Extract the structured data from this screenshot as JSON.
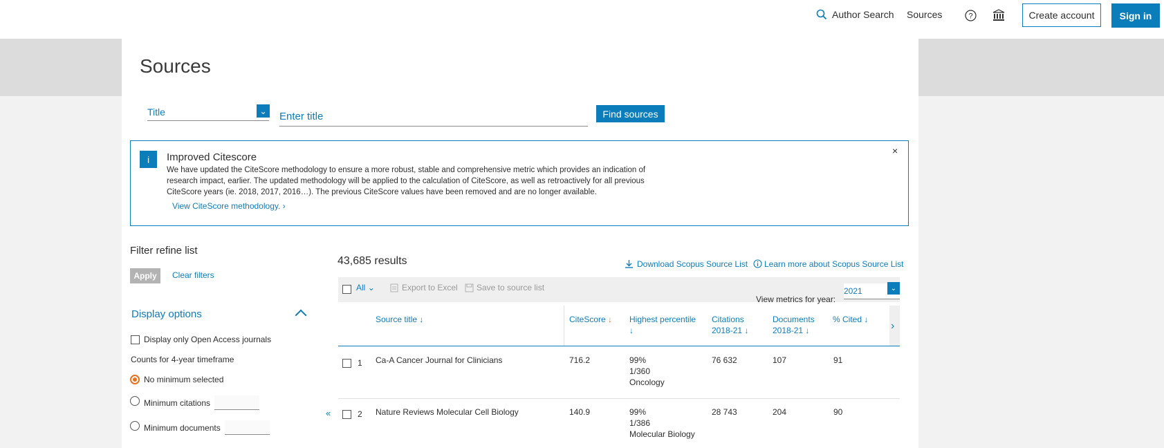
{
  "header": {
    "author_search": "Author Search",
    "sources": "Sources",
    "create_account": "Create account",
    "sign_in": "Sign in"
  },
  "page": {
    "title": "Sources"
  },
  "search": {
    "type_selected": "Title",
    "placeholder": "Enter title",
    "find_button": "Find sources"
  },
  "alert": {
    "icon": "i",
    "title": "Improved Citescore",
    "body": "We have updated the CiteScore methodology to ensure a more robust, stable and comprehensive metric which provides an indication of research impact, earlier. The updated methodology will be applied to the calculation of CiteScore, as well as retroactively for all previous CiteScore years (ie. 2018, 2017, 2016…). The previous CiteScore values have been removed and are no longer available.",
    "link": "View CiteScore methodology. ›",
    "close": "×"
  },
  "filter": {
    "heading": "Filter refine list",
    "apply": "Apply",
    "clear": "Clear filters",
    "display_options": "Display options",
    "open_access": "Display only Open Access journals",
    "counts_label": "Counts for 4-year timeframe",
    "no_minimum": "No minimum selected",
    "min_citations": "Minimum citations",
    "min_documents": "Minimum documents"
  },
  "results": {
    "count": "43,685 results",
    "download": "Download Scopus Source List",
    "learn_more": "Learn more about Scopus Source List",
    "all": "All",
    "export": "Export to Excel",
    "save": "Save to source list",
    "view_metrics": "View metrics for year:",
    "year": "2021",
    "columns": {
      "source_title": "Source title ↓",
      "citescore": "CiteScore ↓",
      "highest_percentile_1": "Highest percentile",
      "highest_percentile_2": "↓",
      "citations_1": "Citations",
      "citations_2": "2018-21 ↓",
      "documents_1": "Documents",
      "documents_2": "2018-21 ↓",
      "cited": "% Cited ↓"
    },
    "rows": [
      {
        "num": "1",
        "title": "Ca-A Cancer Journal for Clinicians",
        "citescore": "716.2",
        "pct": "99%",
        "rank": "1/360",
        "field": "Oncology",
        "citations": "76 632",
        "documents": "107",
        "cited": "91"
      },
      {
        "num": "2",
        "title": "Nature Reviews Molecular Cell Biology",
        "citescore": "140.9",
        "pct": "99%",
        "rank": "1/386",
        "field": "Molecular Biology",
        "citations": "28 743",
        "documents": "204",
        "cited": "90"
      }
    ]
  },
  "colors": {
    "accent": "#0c7dbb",
    "sort_active": "#e9711c"
  }
}
